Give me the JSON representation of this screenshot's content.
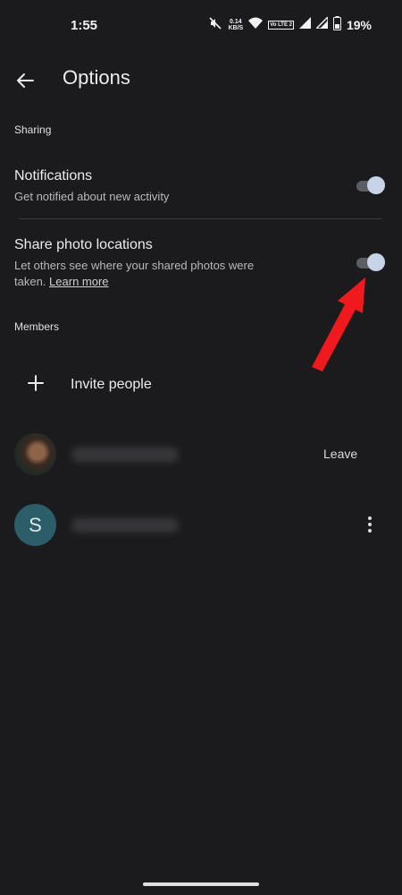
{
  "status_bar": {
    "time": "1:55",
    "net_speed_value": "0.14",
    "net_speed_unit": "KB/S",
    "volte": "Vo LTE 2",
    "battery_percent": "19%"
  },
  "header": {
    "title": "Options"
  },
  "sharing": {
    "section_label": "Sharing",
    "notifications": {
      "title": "Notifications",
      "subtitle": "Get notified about new activity",
      "enabled": true
    },
    "share_locations": {
      "title": "Share photo locations",
      "subtitle": "Let others see where your shared photos were taken.",
      "link": "Learn more",
      "enabled": true
    }
  },
  "members": {
    "section_label": "Members",
    "invite_label": "Invite people",
    "list": [
      {
        "avatar_type": "photo",
        "action": "Leave"
      },
      {
        "avatar_type": "letter",
        "avatar_letter": "S",
        "action_icon": "more-vert-icon"
      }
    ]
  },
  "colors": {
    "background": "#1b1b1d",
    "toggle_thumb": "#c7d3e6",
    "avatar_s": "#2b5e69",
    "annotation_arrow": "#f0191e"
  }
}
